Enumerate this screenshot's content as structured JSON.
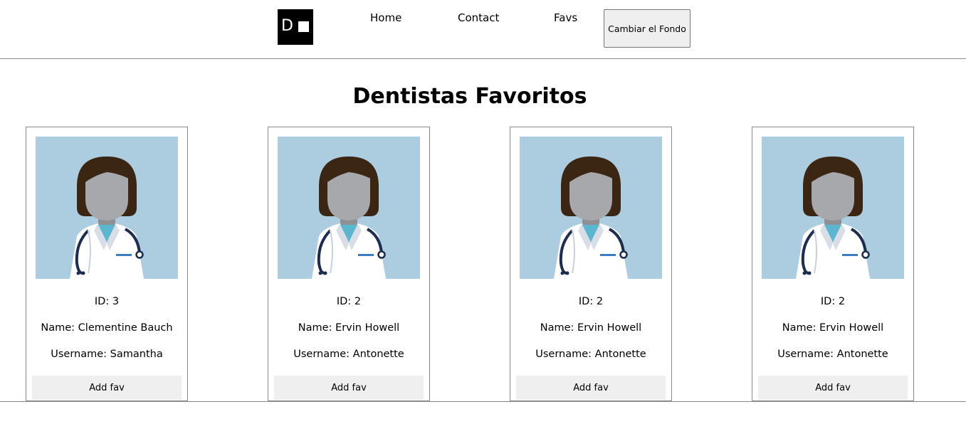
{
  "navbar": {
    "links": [
      {
        "label": "Home"
      },
      {
        "label": "Contact"
      },
      {
        "label": "Favs"
      }
    ],
    "theme_button_label": "Cambiar el Fondo"
  },
  "page_title": "Dentistas Favoritos",
  "cards": [
    {
      "id": "ID: 3",
      "name": "Name: Clementine Bauch",
      "username": "Username: Samantha",
      "button": "Add fav"
    },
    {
      "id": "ID: 2",
      "name": "Name: Ervin Howell",
      "username": "Username: Antonette",
      "button": "Add fav"
    },
    {
      "id": "ID: 2",
      "name": "Name: Ervin Howell",
      "username": "Username: Antonette",
      "button": "Add fav"
    },
    {
      "id": "ID: 2",
      "name": "Name: Ervin Howell",
      "username": "Username: Antonette",
      "button": "Add fav"
    }
  ],
  "colors": {
    "image_background": "#abcddf",
    "hair": "#3b2614",
    "face": "#a7a8ac",
    "coat": "#ffffff",
    "scrubs": "#5bb6cf",
    "stethoscope": "#1d2d4f"
  },
  "icons": {
    "logo": "dh-logo",
    "avatar": "female-dentist-avatar"
  }
}
